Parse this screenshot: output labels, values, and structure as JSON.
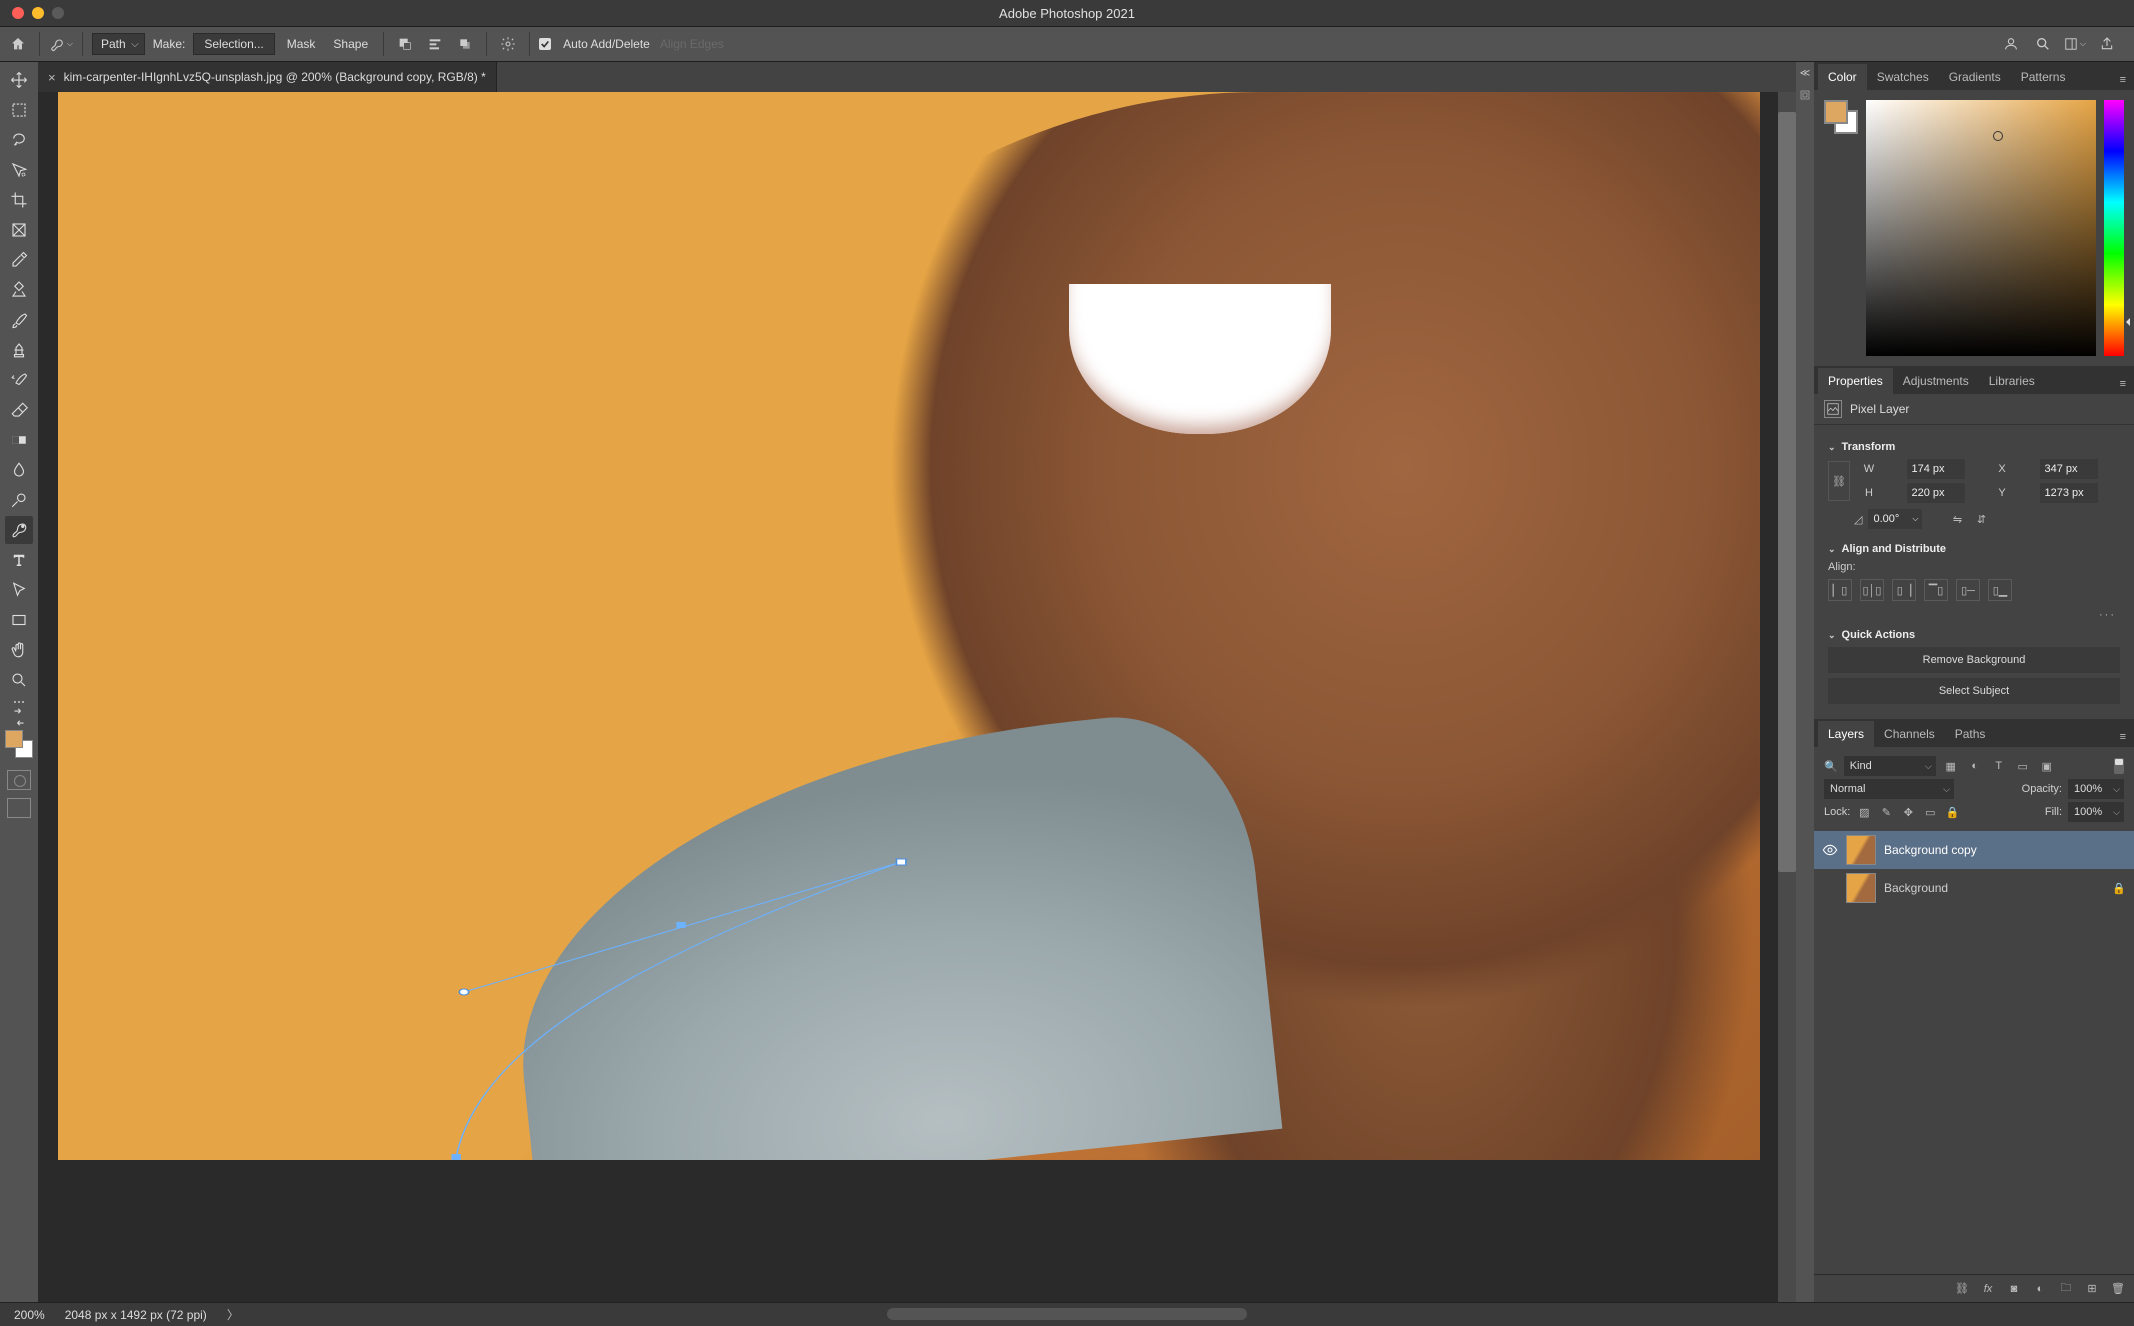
{
  "title": "Adobe Photoshop 2021",
  "optionsbar": {
    "pen_mode": "Path",
    "make_label": "Make:",
    "make_selection": "Selection...",
    "make_mask": "Mask",
    "make_shape": "Shape",
    "auto_add_delete": "Auto Add/Delete",
    "align_edges": "Align Edges"
  },
  "document_tab": {
    "title": "kim-carpenter-IHIgnhLvz5Q-unsplash.jpg @ 200% (Background copy, RGB/8) *"
  },
  "statusbar": {
    "zoom": "200%",
    "info": "2048 px x 1492 px (72 ppi)"
  },
  "panels": {
    "color_tabs": [
      "Color",
      "Swatches",
      "Gradients",
      "Patterns"
    ],
    "props_tabs": [
      "Properties",
      "Adjustments",
      "Libraries"
    ],
    "layers_tabs": [
      "Layers",
      "Channels",
      "Paths"
    ]
  },
  "properties": {
    "pixel_layer_label": "Pixel Layer",
    "transform_label": "Transform",
    "W_label": "W",
    "W": "174 px",
    "X_label": "X",
    "X": "347 px",
    "H_label": "H",
    "H": "220 px",
    "Y_label": "Y",
    "Y": "1273 px",
    "angle": "0.00°",
    "align_label": "Align and Distribute",
    "align_sub": "Align:",
    "quick_actions_label": "Quick Actions",
    "remove_bg": "Remove Background",
    "select_subject": "Select Subject"
  },
  "layers": {
    "kind_label": "Kind",
    "blend_mode": "Normal",
    "opacity_label": "Opacity:",
    "opacity": "100%",
    "lock_label": "Lock:",
    "fill_label": "Fill:",
    "fill": "100%",
    "items": [
      {
        "name": "Background copy",
        "visible": true,
        "selected": true,
        "locked": false
      },
      {
        "name": "Background",
        "visible": false,
        "selected": false,
        "locked": true
      }
    ]
  }
}
